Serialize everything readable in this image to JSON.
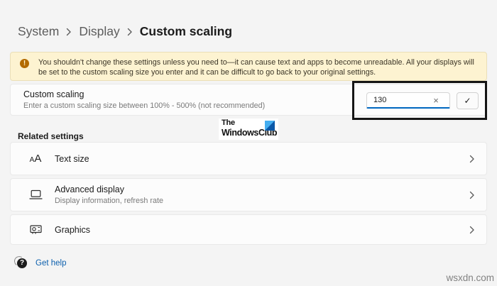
{
  "breadcrumb": {
    "items": [
      "System",
      "Display",
      "Custom scaling"
    ],
    "separator": "›"
  },
  "warning": {
    "icon": "warning-icon",
    "icon_glyph": "!",
    "text": "You shouldn't change these settings unless you need to—it can cause text and apps to become unreadable. All your displays will be set to the custom scaling size you enter and it can be difficult to go back to your original settings."
  },
  "custom_scaling": {
    "title": "Custom scaling",
    "subtitle": "Enter a custom scaling size between 100% - 500% (not recommended)",
    "input_value": "130",
    "clear_glyph": "×",
    "confirm_glyph": "✓"
  },
  "watermark_logo": {
    "line1": "The",
    "line2": "WindowsClub"
  },
  "related_settings": {
    "header": "Related settings",
    "items": [
      {
        "icon": "text-size-icon",
        "label": "Text size",
        "subtitle": ""
      },
      {
        "icon": "advanced-display-icon",
        "label": "Advanced display",
        "subtitle": "Display information, refresh rate"
      },
      {
        "icon": "graphics-icon",
        "label": "Graphics",
        "subtitle": ""
      }
    ]
  },
  "footer": {
    "get_help_label": "Get help",
    "help_glyph": "?"
  },
  "site_watermark": "wsxdn.com",
  "icons": {
    "text_size_small": "A",
    "text_size_big": "A"
  },
  "colors": {
    "accent_blue": "#0067c0",
    "link_blue": "#0b5fad",
    "warning_bg": "#fdf3d1",
    "warning_icon": "#b26a00",
    "page_bg": "#f4f4f4",
    "card_bg": "#fcfcfc",
    "annotation_border": "#151515"
  }
}
